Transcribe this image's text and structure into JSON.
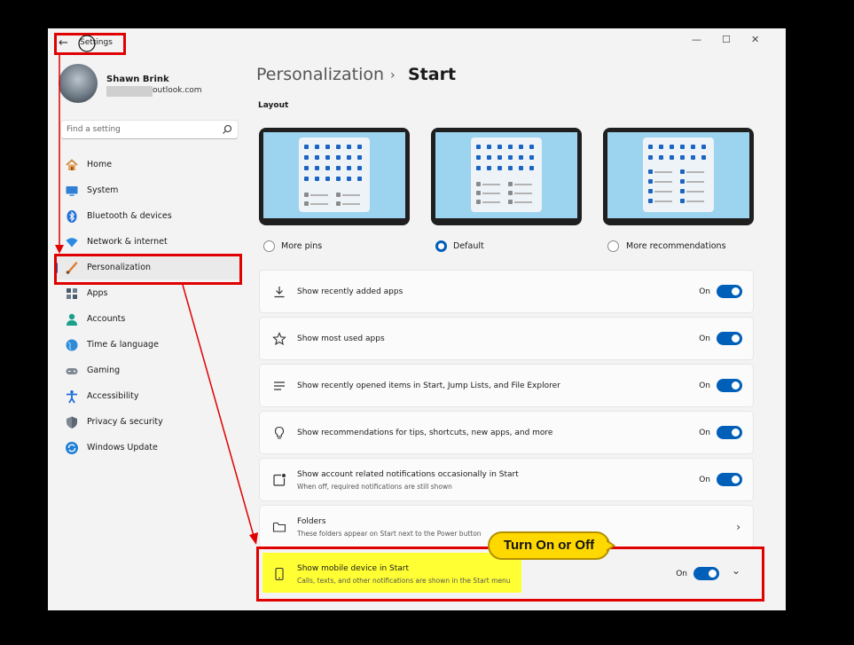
{
  "window": {
    "title": "Settings",
    "back_glyph": "←",
    "min_glyph": "—",
    "max_glyph": "☐",
    "close_glyph": "✕"
  },
  "user": {
    "name": "Shawn Brink",
    "email_visible": "outlook.com"
  },
  "search": {
    "placeholder": "Find a setting"
  },
  "sidebar": {
    "items": [
      {
        "label": "Home",
        "icon": "home-icon"
      },
      {
        "label": "System",
        "icon": "monitor-icon"
      },
      {
        "label": "Bluetooth & devices",
        "icon": "bluetooth-icon"
      },
      {
        "label": "Network & internet",
        "icon": "wifi-icon"
      },
      {
        "label": "Personalization",
        "icon": "brush-icon",
        "selected": true
      },
      {
        "label": "Apps",
        "icon": "apps-icon"
      },
      {
        "label": "Accounts",
        "icon": "person-icon"
      },
      {
        "label": "Time & language",
        "icon": "globe-icon"
      },
      {
        "label": "Gaming",
        "icon": "gamepad-icon"
      },
      {
        "label": "Accessibility",
        "icon": "accessibility-icon"
      },
      {
        "label": "Privacy & security",
        "icon": "shield-icon"
      },
      {
        "label": "Windows Update",
        "icon": "update-icon"
      }
    ]
  },
  "breadcrumb": {
    "parent": "Personalization",
    "separator": "›",
    "current": "Start"
  },
  "layout": {
    "title": "Layout",
    "options": [
      {
        "label": "More pins",
        "selected": false
      },
      {
        "label": "Default",
        "selected": true
      },
      {
        "label": "More recommendations",
        "selected": false
      }
    ]
  },
  "settings": [
    {
      "title": "Show recently added apps",
      "subtitle": "",
      "state": "On",
      "icon": "download-icon",
      "control": "toggle"
    },
    {
      "title": "Show most used apps",
      "subtitle": "",
      "state": "On",
      "icon": "star-icon",
      "control": "toggle"
    },
    {
      "title": "Show recently opened items in Start, Jump Lists, and File Explorer",
      "subtitle": "",
      "state": "On",
      "icon": "list-icon",
      "control": "toggle"
    },
    {
      "title": "Show recommendations for tips, shortcuts, new apps, and more",
      "subtitle": "",
      "state": "On",
      "icon": "lightbulb-icon",
      "control": "toggle"
    },
    {
      "title": "Show account related notifications occasionally in Start",
      "subtitle": "When off, required notifications are still shown",
      "state": "On",
      "icon": "notification-icon",
      "control": "toggle"
    },
    {
      "title": "Folders",
      "subtitle": "These folders appear on Start next to the Power button",
      "state": "",
      "icon": "folder-icon",
      "control": "chevron",
      "chevron_glyph": "›"
    },
    {
      "title": "Show mobile device in Start",
      "subtitle": "Calls, texts, and other notifications are shown in the Start menu",
      "state": "On",
      "icon": "phone-icon",
      "control": "toggle-expand",
      "chevron_glyph": "⌄"
    }
  ],
  "callout": {
    "text": "Turn On or Off"
  },
  "colors": {
    "accent": "#005fb8",
    "annotation_red": "#e00000",
    "highlight_yellow": "#ffff33",
    "callout_yellow": "#ffd800"
  }
}
